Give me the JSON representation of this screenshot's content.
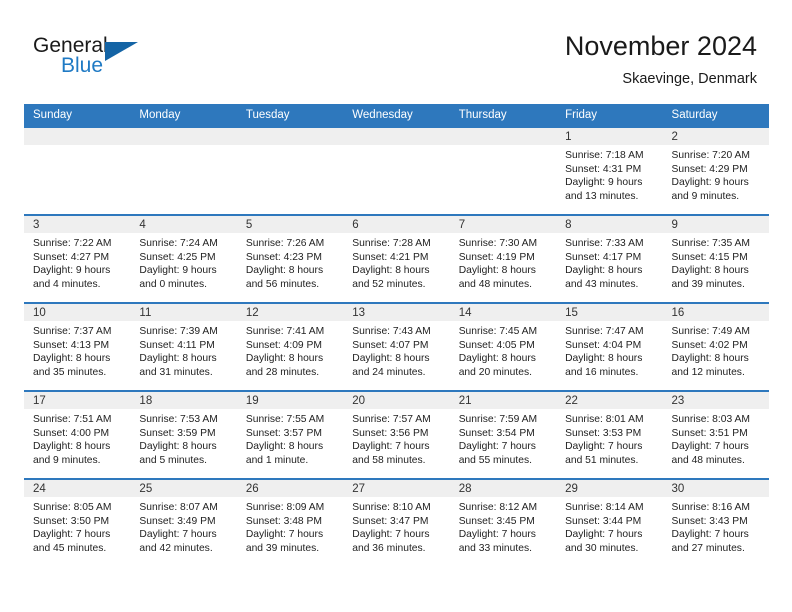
{
  "brand": {
    "word1": "General",
    "word2": "Blue",
    "triangle_color": "#1464a5",
    "blue_text_color": "#1f7ac4"
  },
  "header": {
    "title": "November 2024",
    "subtitle": "Skaevinge, Denmark"
  },
  "theme": {
    "header_blue": "#2e78bd",
    "daynum_strip": "#efefef",
    "text": "#222222"
  },
  "weekdays": [
    "Sunday",
    "Monday",
    "Tuesday",
    "Wednesday",
    "Thursday",
    "Friday",
    "Saturday"
  ],
  "weeks": [
    [
      {
        "day": "",
        "lines": []
      },
      {
        "day": "",
        "lines": []
      },
      {
        "day": "",
        "lines": []
      },
      {
        "day": "",
        "lines": []
      },
      {
        "day": "",
        "lines": []
      },
      {
        "day": "1",
        "lines": [
          "Sunrise: 7:18 AM",
          "Sunset: 4:31 PM",
          "Daylight: 9 hours",
          "and 13 minutes."
        ]
      },
      {
        "day": "2",
        "lines": [
          "Sunrise: 7:20 AM",
          "Sunset: 4:29 PM",
          "Daylight: 9 hours",
          "and 9 minutes."
        ]
      }
    ],
    [
      {
        "day": "3",
        "lines": [
          "Sunrise: 7:22 AM",
          "Sunset: 4:27 PM",
          "Daylight: 9 hours",
          "and 4 minutes."
        ]
      },
      {
        "day": "4",
        "lines": [
          "Sunrise: 7:24 AM",
          "Sunset: 4:25 PM",
          "Daylight: 9 hours",
          "and 0 minutes."
        ]
      },
      {
        "day": "5",
        "lines": [
          "Sunrise: 7:26 AM",
          "Sunset: 4:23 PM",
          "Daylight: 8 hours",
          "and 56 minutes."
        ]
      },
      {
        "day": "6",
        "lines": [
          "Sunrise: 7:28 AM",
          "Sunset: 4:21 PM",
          "Daylight: 8 hours",
          "and 52 minutes."
        ]
      },
      {
        "day": "7",
        "lines": [
          "Sunrise: 7:30 AM",
          "Sunset: 4:19 PM",
          "Daylight: 8 hours",
          "and 48 minutes."
        ]
      },
      {
        "day": "8",
        "lines": [
          "Sunrise: 7:33 AM",
          "Sunset: 4:17 PM",
          "Daylight: 8 hours",
          "and 43 minutes."
        ]
      },
      {
        "day": "9",
        "lines": [
          "Sunrise: 7:35 AM",
          "Sunset: 4:15 PM",
          "Daylight: 8 hours",
          "and 39 minutes."
        ]
      }
    ],
    [
      {
        "day": "10",
        "lines": [
          "Sunrise: 7:37 AM",
          "Sunset: 4:13 PM",
          "Daylight: 8 hours",
          "and 35 minutes."
        ]
      },
      {
        "day": "11",
        "lines": [
          "Sunrise: 7:39 AM",
          "Sunset: 4:11 PM",
          "Daylight: 8 hours",
          "and 31 minutes."
        ]
      },
      {
        "day": "12",
        "lines": [
          "Sunrise: 7:41 AM",
          "Sunset: 4:09 PM",
          "Daylight: 8 hours",
          "and 28 minutes."
        ]
      },
      {
        "day": "13",
        "lines": [
          "Sunrise: 7:43 AM",
          "Sunset: 4:07 PM",
          "Daylight: 8 hours",
          "and 24 minutes."
        ]
      },
      {
        "day": "14",
        "lines": [
          "Sunrise: 7:45 AM",
          "Sunset: 4:05 PM",
          "Daylight: 8 hours",
          "and 20 minutes."
        ]
      },
      {
        "day": "15",
        "lines": [
          "Sunrise: 7:47 AM",
          "Sunset: 4:04 PM",
          "Daylight: 8 hours",
          "and 16 minutes."
        ]
      },
      {
        "day": "16",
        "lines": [
          "Sunrise: 7:49 AM",
          "Sunset: 4:02 PM",
          "Daylight: 8 hours",
          "and 12 minutes."
        ]
      }
    ],
    [
      {
        "day": "17",
        "lines": [
          "Sunrise: 7:51 AM",
          "Sunset: 4:00 PM",
          "Daylight: 8 hours",
          "and 9 minutes."
        ]
      },
      {
        "day": "18",
        "lines": [
          "Sunrise: 7:53 AM",
          "Sunset: 3:59 PM",
          "Daylight: 8 hours",
          "and 5 minutes."
        ]
      },
      {
        "day": "19",
        "lines": [
          "Sunrise: 7:55 AM",
          "Sunset: 3:57 PM",
          "Daylight: 8 hours",
          "and 1 minute."
        ]
      },
      {
        "day": "20",
        "lines": [
          "Sunrise: 7:57 AM",
          "Sunset: 3:56 PM",
          "Daylight: 7 hours",
          "and 58 minutes."
        ]
      },
      {
        "day": "21",
        "lines": [
          "Sunrise: 7:59 AM",
          "Sunset: 3:54 PM",
          "Daylight: 7 hours",
          "and 55 minutes."
        ]
      },
      {
        "day": "22",
        "lines": [
          "Sunrise: 8:01 AM",
          "Sunset: 3:53 PM",
          "Daylight: 7 hours",
          "and 51 minutes."
        ]
      },
      {
        "day": "23",
        "lines": [
          "Sunrise: 8:03 AM",
          "Sunset: 3:51 PM",
          "Daylight: 7 hours",
          "and 48 minutes."
        ]
      }
    ],
    [
      {
        "day": "24",
        "lines": [
          "Sunrise: 8:05 AM",
          "Sunset: 3:50 PM",
          "Daylight: 7 hours",
          "and 45 minutes."
        ]
      },
      {
        "day": "25",
        "lines": [
          "Sunrise: 8:07 AM",
          "Sunset: 3:49 PM",
          "Daylight: 7 hours",
          "and 42 minutes."
        ]
      },
      {
        "day": "26",
        "lines": [
          "Sunrise: 8:09 AM",
          "Sunset: 3:48 PM",
          "Daylight: 7 hours",
          "and 39 minutes."
        ]
      },
      {
        "day": "27",
        "lines": [
          "Sunrise: 8:10 AM",
          "Sunset: 3:47 PM",
          "Daylight: 7 hours",
          "and 36 minutes."
        ]
      },
      {
        "day": "28",
        "lines": [
          "Sunrise: 8:12 AM",
          "Sunset: 3:45 PM",
          "Daylight: 7 hours",
          "and 33 minutes."
        ]
      },
      {
        "day": "29",
        "lines": [
          "Sunrise: 8:14 AM",
          "Sunset: 3:44 PM",
          "Daylight: 7 hours",
          "and 30 minutes."
        ]
      },
      {
        "day": "30",
        "lines": [
          "Sunrise: 8:16 AM",
          "Sunset: 3:43 PM",
          "Daylight: 7 hours",
          "and 27 minutes."
        ]
      }
    ]
  ]
}
